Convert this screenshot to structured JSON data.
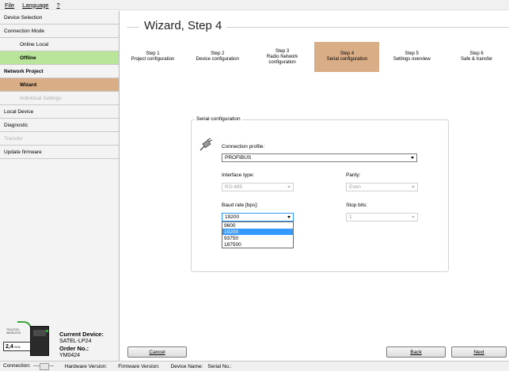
{
  "menu": [
    "File",
    "Language",
    "?"
  ],
  "sidebar": {
    "items": [
      {
        "label": "Device Selection"
      },
      {
        "label": "Connection Mode"
      },
      {
        "label": "Online Local"
      },
      {
        "label": "Offline"
      },
      {
        "label": "Network Project"
      },
      {
        "label": "Wizard"
      },
      {
        "label": "Individual Settings"
      },
      {
        "label": "Local Device"
      },
      {
        "label": "Diagnostic"
      },
      {
        "label": "Transfer"
      },
      {
        "label": "Update firmware"
      }
    ],
    "device": {
      "trusted_text": "TRUSTED WIRELESS",
      "badge": "2,4",
      "badge_unit": "GHz",
      "current_device_label": "Current Device:",
      "current_device_value": "SATEL-LP24",
      "order_no_label": "Order No.:",
      "order_no_value": "YM0424"
    }
  },
  "main": {
    "title": "Wizard, Step 4",
    "steps": [
      {
        "line1": "Step 1",
        "line2": "Project configuration"
      },
      {
        "line1": "Step 2",
        "line2": "Device configuration"
      },
      {
        "line1": "Step 3",
        "line2": "Radio Network",
        "line3": "configuration"
      },
      {
        "line1": "Step 4",
        "line2": "Serial configuration"
      },
      {
        "line1": "Step 5",
        "line2": "Settings overview"
      },
      {
        "line1": "Step 6",
        "line2": "Safe & transfer"
      }
    ],
    "serial": {
      "legend": "Serial configuration",
      "connection_profile_label": "Connection profile:",
      "connection_profile_value": "PROFIBUS",
      "interface_type_label": "Interface type:",
      "interface_type_value": "RS-485",
      "parity_label": "Parity:",
      "parity_value": "Even",
      "baud_rate_label": "Baud rate [bps]:",
      "baud_rate_value": "19200",
      "stop_bits_label": "Stop bits:",
      "stop_bits_value": "1",
      "baud_options": [
        "9600",
        "19200",
        "93750",
        "187500"
      ]
    },
    "buttons": {
      "cancel": "Cancel",
      "back": "Back",
      "next": "Next"
    }
  },
  "status": {
    "connection": "Connection:",
    "hardware": "Hardware Version:",
    "firmware": "Firmware Version:",
    "device_name": "Device Name:",
    "serial_no": "Serial No.:"
  },
  "colors": {
    "active_step": "#d9ad86",
    "offline": "#b8e59a",
    "selected_option": "#3399ff"
  }
}
